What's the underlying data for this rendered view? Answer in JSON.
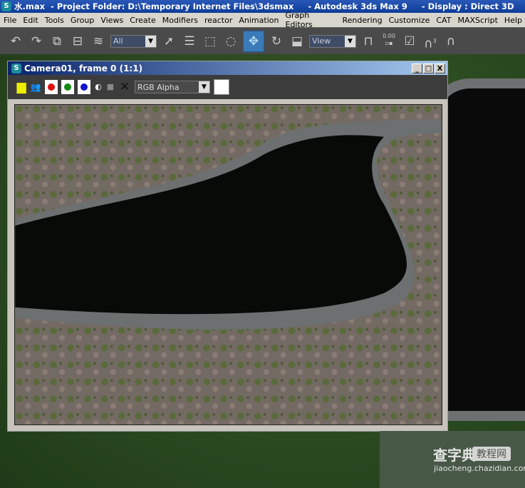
{
  "app": {
    "title_file": "水.max",
    "title_project": "  - Project Folder: D:\\Temporary Internet Files\\3dsmax",
    "title_app": "     - Autodesk 3ds Max 9",
    "title_display": "     - Display : Direct 3D"
  },
  "menu": [
    "File",
    "Edit",
    "Tools",
    "Group",
    "Views",
    "Create",
    "Modifiers",
    "reactor",
    "Animation",
    "Graph Editors",
    "Rendering",
    "Customize",
    "CAT",
    "MAXScript",
    "Help"
  ],
  "toolbar": {
    "selection_filter": "All",
    "reference_coord": "View",
    "snap_value": "0.00",
    "snap_count": "3"
  },
  "render_window": {
    "title": "Camera01, frame 0 (1:1)",
    "channel_display": "RGB Alpha",
    "colors": {
      "red": "#e01010",
      "green": "#108a10",
      "blue": "#1010d0"
    },
    "controls": {
      "minimize": "_",
      "maximize": "□",
      "close": "X"
    }
  },
  "watermark": {
    "brand": "查字典",
    "label": "教程网",
    "url": "jiaocheng.chazidian.com"
  }
}
